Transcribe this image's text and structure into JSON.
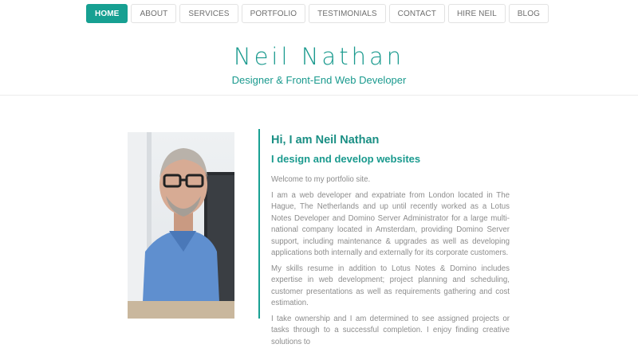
{
  "nav": {
    "items": [
      {
        "label": "HOME",
        "active": true
      },
      {
        "label": "ABOUT"
      },
      {
        "label": "SERVICES"
      },
      {
        "label": "PORTFOLIO"
      },
      {
        "label": "TESTIMONIALS"
      },
      {
        "label": "CONTACT"
      },
      {
        "label": "HIRE NEIL"
      },
      {
        "label": "BLOG"
      }
    ]
  },
  "header": {
    "title": "Neil Nathan",
    "subtitle": "Designer & Front-End Web Developer"
  },
  "about": {
    "heading": "Hi, I am Neil Nathan",
    "tagline": "I design and develop websites",
    "paragraphs": [
      "Welcome to my portfolio site.",
      "I am a web developer and expatriate from London located in The Hague, The Netherlands and up until recently worked as a Lotus Notes Developer and Domino Server Administrator for a large multi-national company located in Amsterdam, providing Domino Server support, including maintenance & upgrades as well as developing applications both internally and externally for its corporate customers.",
      "My skills resume in addition to Lotus Notes & Domino includes expertise in web development; project planning and scheduling, customer presentations as well as requirements gathering and cost estimation.",
      "I take ownership and I am determined to see assigned projects or tasks through to a successful completion. I enjoy finding creative solutions to"
    ]
  },
  "colors": {
    "accent": "#17a092",
    "text": "#8c8c8c"
  }
}
